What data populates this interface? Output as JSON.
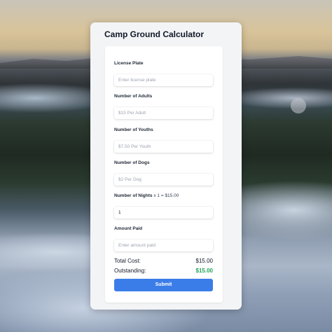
{
  "app": {
    "title": "Camp Ground Calculator"
  },
  "fields": [
    {
      "label": "License Plate",
      "placeholder": "Enter license plate",
      "value": ""
    },
    {
      "label": "Number of Adults",
      "placeholder": "$15 Per Adult",
      "value": ""
    },
    {
      "label": "Number of Youths",
      "placeholder": "$7.50 Per Youth",
      "value": ""
    },
    {
      "label": "Number of Dogs",
      "placeholder": "$2 Per Dog",
      "value": ""
    },
    {
      "label": "Number of Nights",
      "label_suffix": "x 1 = $15.00",
      "placeholder": "",
      "value": "1"
    },
    {
      "label": "Amount Paid",
      "placeholder": "Enter amount paid",
      "value": ""
    }
  ],
  "summary": {
    "total_label": "Total Cost:",
    "total_value": "$15.00",
    "outstanding_label": "Outstanding:",
    "outstanding_value": "$15.00"
  },
  "submit_label": "Submit",
  "colors": {
    "accent": "#3b7de8",
    "outstanding": "#22a35a"
  }
}
